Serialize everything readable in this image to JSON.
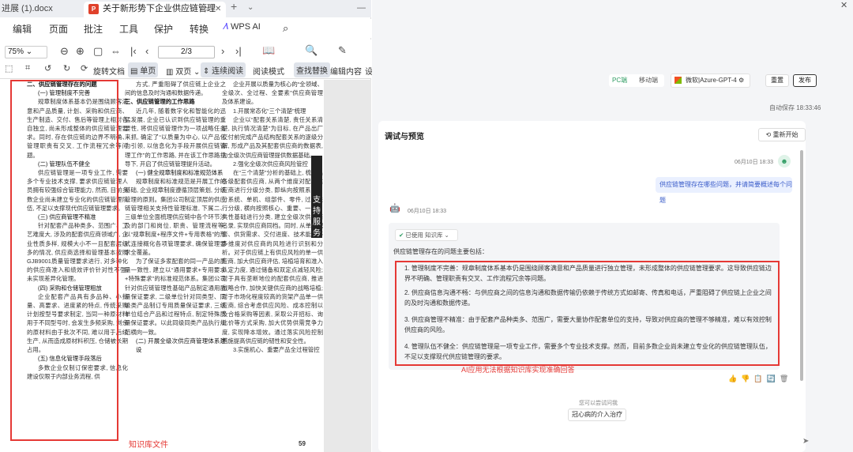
{
  "wps": {
    "tab1_label": "进展 (1).docx",
    "tab2_label": "关于新形势下企业供应链管理",
    "pdf_badge": "P",
    "tab_close": "✕",
    "tab_new": "+",
    "menu": [
      "编辑",
      "页面",
      "批注",
      "工具",
      "保护",
      "转换"
    ],
    "wps_ai_label": "WPS AI",
    "zoom_value": "75%",
    "page_value": "2/3",
    "rotate_label": "旋转文档",
    "single_label": "单页",
    "double_label": "双页",
    "continuous_label": "连续阅读",
    "read_mode_label": "阅读模式",
    "find_replace_label": "查找替换",
    "edit_content_label": "编辑内容",
    "more_label": "设"
  },
  "document": {
    "col1": [
      {
        "style": "h2",
        "text": "二、供应链管理存在的问题"
      },
      {
        "style": "h3",
        "text": "(一) 管理制度不完善"
      },
      {
        "style": "p",
        "text": "规章制度体系基本仍是围绕顾客满意和产品质量, 计划、采购和供应商、生产制造、交付、售后等管理上相对各自独立, 尚未形成整体的供应链管理要求。同时, 存在供应链的边界不明确、管理职责有交叉, 工作流程冗余等问题。"
      },
      {
        "style": "h3",
        "text": "(二) 管理队伍不健全"
      },
      {
        "style": "p",
        "text": "供应链管理是一项专业工作, 需要多个专业技术支撑, 要求供应链管理人员拥有较强综合管理能力, 然而, 目前多数企业尚未建立专业化的供应链管理队伍, 不足以支撑现代供应链管理要求。"
      },
      {
        "style": "h3",
        "text": "(三) 供应商管理不精准"
      },
      {
        "style": "p",
        "text": "针对配套产品种类多、范围广、工艺难度大, 涉及的配套供应商领域广, 企业性质多样, 规模大小不一且配套层级多的情况, 供应商选择和管理基本按照GJB9001质量管理要求进行, 对多种化的供应商准入和绩效评价针对性不强, 未实现差异化管理。"
      },
      {
        "style": "h3",
        "text": "(四) 采购和仓储管理粗放"
      },
      {
        "style": "p",
        "text": "企业配套产品具有多品种、小批量、高要求、进度紧的特点, 传统采购计划按型号要求制定, 当同一种原材料用于不同型号时, 会发生多频采购, 剩余的原材料由于批次不同, 难以用于后续生产, 从而造成原材料积压, 仓储被长期占用。"
      },
      {
        "style": "h3",
        "text": "(五) 信息化管理手段落后"
      },
      {
        "style": "p",
        "text": "多数企业仅制订保密要求, 信息化建设仅限于内部业务流程, 供"
      }
    ],
    "col2": [
      {
        "style": "p",
        "text": "方式, 严重阻碍了供应链上企业之间的信息及时沟通和数据传递。"
      },
      {
        "style": "h2",
        "text": "三、供应链管理的工作思路"
      },
      {
        "style": "p",
        "text": "近几年, 随着数字化和智能化的迅猛发展, 企业已认识到供应链管理的重要性, 将供应链管理作为一项战略任务来抓, 确定了“以质量为中心, 以产品化为引领, 以信息化为手段开展供应链管理工作”的工作思路, 并在该工作思路指导下, 开启了供应链管理提升活动。"
      },
      {
        "style": "h3",
        "text": "(一) 健全规章制度和标准规范体系"
      },
      {
        "style": "p",
        "text": "规章制度和标准规范是开展工作的基础, 企业规章制度遵循顶层策划, 分级管理的原则。集团公司制定顶层的供应链管理相关支持性管理标准, 下属二、三级单位全面梳理供应链中各个环节涉及的部门和岗位, 职责、管理流程等, 以“规章制度+程序文件+专用表格”的形式连接概化各项管理要求, 确保管理要求全覆盖。"
      },
      {
        "style": "p",
        "text": "为了保证多家配套的同一产品的质量一致性, 建立以“通用要求+专用要求+特殊要求”的标准规范体系。集团公司针对供应链管理性基础产品制定通用质量保证要求, 二级单位针对同类型、同级类产品制订专用质量保证要求, 三级单位结合产品和过程特点, 制定特殊质量保证要求。以此同级同类产品执行规范横向一致。"
      },
      {
        "style": "h3",
        "text": "(二) 开展全级次供应商管理体系建设"
      }
    ],
    "col3": [
      {
        "style": "p",
        "text": "企业开展以质量为核心的“全领域、全级次、全过程、全要素”供应商管理及体系建设。"
      },
      {
        "style": "p",
        "text": "1.开展常态化“三个清楚”梳理"
      },
      {
        "style": "p",
        "text": "企业以“配套关系清楚, 责任关系清楚, 执行情况清楚”为目标, 在产品出厂交付前完成产品结构配套关系的逐级分解, 形成产品及其配套供应商的数据表, 为全级次供应商管理提供数据基础。"
      },
      {
        "style": "p",
        "text": "2.强化全级次供应商风险管控"
      },
      {
        "style": "p",
        "text": "在“三个清楚”分析的基础上, 梳理出各级配套供应商, 从两个维度对配套供应商进行分级分类, 即纵向按照系统、分系统、单机、组部件、零件, 过程进行分级, 横向按照核心、重要、一般、共性基础进行分类, 建立全级次供应商名录, 实现供应商同档。同时, 从单一配套、供货需求、交付进度、技术能力等多维度对供应商的风险进行识别和分析。对于供应链上有供应风险的单一供应商, 加大供应商评估, 培植培育和准入认定力度, 通过储备和双定点减轻风险; 对于具有垄断地位的配套供应商, 推进战略合作, 加快关键供应商的战略培植; 对于市场化程度较高的货架产品单一供应商, 综合考虑供应风险、成本控制以及合格采购等因素, 采取公开招标、询比价等方式采购, 加大优势供需竞争力度, 实现降本增效。通过落实风险控制措施提高供应链的韧性和安全性。"
      },
      {
        "style": "p",
        "text": "3.实施机心、重要产品全过程管控"
      }
    ],
    "page_number": "59",
    "support_label": "支持服务",
    "kb_label": "知识库文件"
  },
  "app": {
    "window_close": "✕",
    "pc_tab": "PC端",
    "mobile_tab": "移动端",
    "model_label": "微软|Azure-GPT-4",
    "model_settings": "⚙",
    "reset_label": "重置",
    "publish_label": "发布",
    "autosave": "自动保存 18:33:46",
    "panel_title": "调试与预览",
    "restart_label": "重新开始",
    "user_date": "06月10日 18:33",
    "user_avatar": "☻",
    "user_message": "供应链管理存在哪些问题，并请简要概述每个问题",
    "bot_avatar": "🤖",
    "bot_date": "06月10日 18:33",
    "kb_used_label": "已使用  知识库 ⌄",
    "kb_check": "✔",
    "answer_intro": "供应链管理存在的问题主要包括：",
    "answers": [
      "1. 管理制度不完善：规章制度体系基本仍是围绕顾客满意和产品质量进行独立管理，未形成整体的供应链管理要求。这导致供应链边界不明确、管理职责有交叉、工作流程冗余等问题。",
      "2. 供应商信息沟通不畅：与供应商之间的信息沟通和数据传输仍依赖于传统方式如邮寄、传真和电话，严重阻碍了供应链上企业之间的及时沟通和数据传递。",
      "3. 供应商管理不精准：由于配套产品种类多、范围广，需要大量协作配套单位的支持，导致对供应商的管理不够精准，难以有效控制供应商的风险。",
      "4. 管理队伍不健全：供应链管理是一项专业工作，需要多个专业技术支撑。然而，目前多数企业尚未建立专业化的供应链管理队伍，不足以支撑现代供应链管理的要求。"
    ],
    "error_note": "AI应用无法根据知识库实现准确回答",
    "action_icons": "👍👎📋🔄🗑",
    "suggest_label": "您可以尝试问我",
    "suggest_item": "冠心病的介入治疗",
    "send_icon": "➤"
  }
}
